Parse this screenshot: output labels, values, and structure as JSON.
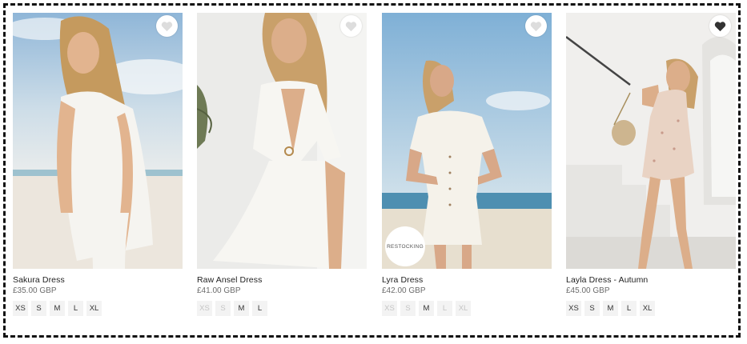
{
  "products": [
    {
      "name": "Sakura Dress",
      "price": "£35.00 GBP",
      "sizes": [
        "XS",
        "S",
        "M",
        "L",
        "XL"
      ],
      "available": [
        true,
        true,
        true,
        true,
        true
      ],
      "badge": ""
    },
    {
      "name": "Raw Ansel Dress",
      "price": "£41.00 GBP",
      "sizes": [
        "XS",
        "S",
        "M",
        "L"
      ],
      "available": [
        false,
        false,
        true,
        true
      ],
      "badge": ""
    },
    {
      "name": "Lyra Dress",
      "price": "£42.00 GBP",
      "sizes": [
        "XS",
        "S",
        "M",
        "L",
        "XL"
      ],
      "available": [
        false,
        false,
        true,
        false,
        false
      ],
      "badge": "RESTOCKING"
    },
    {
      "name": "Layla Dress - Autumn",
      "price": "£45.00 GBP",
      "sizes": [
        "XS",
        "S",
        "M",
        "L",
        "XL"
      ],
      "available": [
        true,
        true,
        true,
        true,
        true
      ],
      "badge": ""
    }
  ],
  "icons": {
    "wishlist": "heart-icon"
  },
  "colors": {
    "heart_fill": "#dddddd",
    "size_chip_bg": "#f3f3f3",
    "unavailable_size": "#c4c4c4",
    "frame_border": "#111111"
  }
}
